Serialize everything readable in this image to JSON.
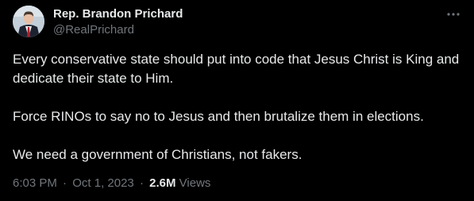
{
  "author": {
    "name": "Rep. Brandon Prichard",
    "handle": "@RealPrichard"
  },
  "more_icon": "ellipsis-icon",
  "tweet": {
    "paragraphs": [
      "Every conservative state should put into code that Jesus Christ is King and dedicate their state to Him.",
      "Force RINOs to say no to Jesus and then brutalize them in elections.",
      "We need a government of Christians, not fakers."
    ]
  },
  "meta": {
    "time": "6:03 PM",
    "separator": "·",
    "date": "Oct 1, 2023",
    "views_count": "2.6M",
    "views_label": "Views"
  },
  "colors": {
    "background": "#000000",
    "primary_text": "#e7e9ea",
    "secondary_text": "#71767b"
  }
}
